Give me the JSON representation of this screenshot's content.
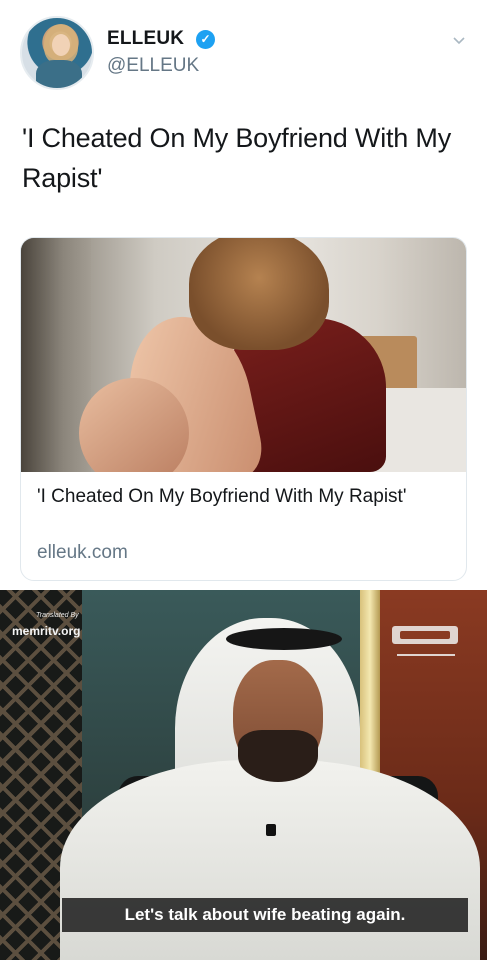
{
  "tweet": {
    "display_name": "ELLEUK",
    "handle": "@ELLEUK",
    "text": "'I Cheated On My Boyfriend With My Rapist'",
    "icons": {
      "verified": "verified-badge-icon",
      "menu": "chevron-down-icon"
    },
    "colors": {
      "verified": "#1da1f2",
      "secondary_text": "#657786"
    }
  },
  "card": {
    "title": "'I Cheated On My Boyfriend With My Rapist'",
    "domain": "elleuk.com"
  },
  "video": {
    "watermark_small": "Translated By",
    "watermark": "memritv.org",
    "subtitle": "Let's talk about wife beating again."
  }
}
